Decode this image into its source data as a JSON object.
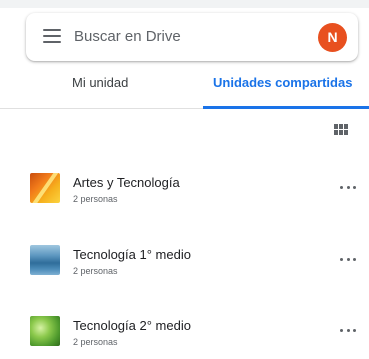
{
  "search": {
    "placeholder": "Buscar en Drive"
  },
  "account": {
    "avatar_letter": "N",
    "avatar_color": "#e8501f"
  },
  "tabs": [
    {
      "label": "Mi unidad",
      "active": false
    },
    {
      "label": "Unidades compartidas",
      "active": true
    }
  ],
  "theme": {
    "accent": "#1a73e8",
    "icon_gray": "#5f6368",
    "text_primary": "#202124",
    "text_secondary": "#5f6368"
  },
  "toolbar": {
    "view_toggle_icon": "grid-view-icon"
  },
  "drives": [
    {
      "name": "Artes y Tecnología",
      "members": "2 personas",
      "thumbnail": "orange-yellow-abstract"
    },
    {
      "name": "Tecnología 1° medio",
      "members": "2 personas",
      "thumbnail": "blue-water"
    },
    {
      "name": "Tecnología 2° medio",
      "members": "2 personas",
      "thumbnail": "green-leaf"
    }
  ]
}
